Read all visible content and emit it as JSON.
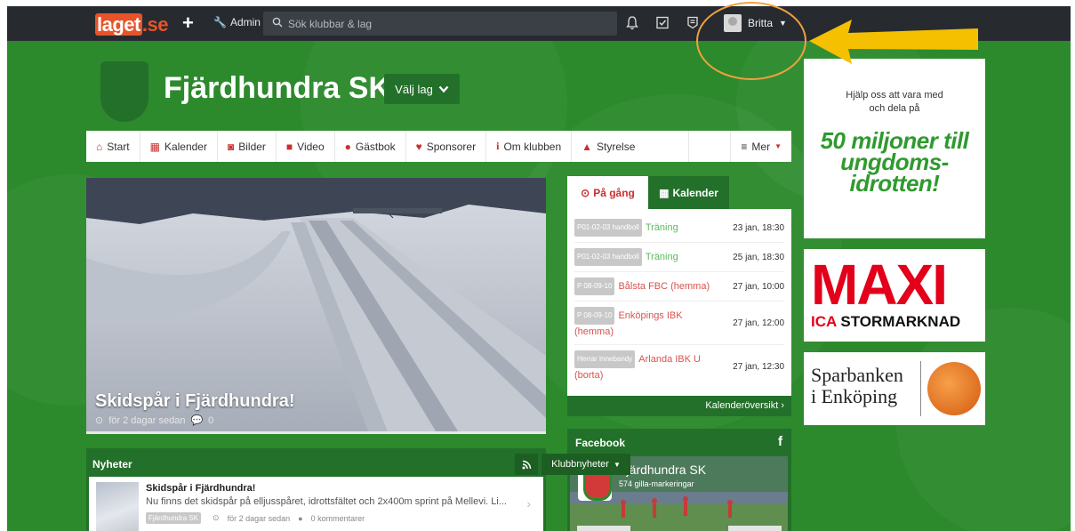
{
  "topbar": {
    "logo_main": "laget",
    "logo_suffix": ".se",
    "admin_label": "Admin",
    "search_placeholder": "Sök klubbar & lag",
    "user_name": "Britta"
  },
  "club": {
    "name": "Fjärdhundra SK",
    "select_team_label": "Välj lag"
  },
  "nav": [
    {
      "label": "Start",
      "icon": "home-icon"
    },
    {
      "label": "Kalender",
      "icon": "calendar-icon"
    },
    {
      "label": "Bilder",
      "icon": "camera-icon"
    },
    {
      "label": "Video",
      "icon": "video-icon"
    },
    {
      "label": "Gästbok",
      "icon": "comments-icon"
    },
    {
      "label": "Sponsorer",
      "icon": "heart-icon"
    },
    {
      "label": "Om klubben",
      "icon": "info-icon"
    },
    {
      "label": "Styrelse",
      "icon": "user-icon"
    }
  ],
  "nav_more": "Mer",
  "hero": {
    "title": "Skidspår i Fjärdhundra!",
    "time": "för 2 dagar sedan",
    "comments": "0"
  },
  "calendar": {
    "tab_upcoming": "På gång",
    "tab_calendar": "Kalender",
    "events": [
      {
        "team": "P01-02-03 handboll",
        "name": "Träning",
        "date": "23 jan, 18:30"
      },
      {
        "team": "P01-02-03 handboll",
        "name": "Träning",
        "date": "25 jan, 18:30"
      },
      {
        "team": "P 08-09-10",
        "name": "Bålsta FBC (hemma)",
        "date": "27 jan, 10:00"
      },
      {
        "team": "P 08-09-10",
        "name": "Enköpings IBK (hemma)",
        "date": "27 jan, 12:00"
      },
      {
        "team": "Herrar Innebandy",
        "name": "Arlanda IBK U (borta)",
        "date": "27 jan, 12:30"
      }
    ],
    "footer_link": "Kalenderöversikt"
  },
  "facebook": {
    "heading": "Facebook",
    "page_name": "Fjärdhundra SK",
    "likes": "574 gilla-markeringar"
  },
  "news": {
    "heading": "Nyheter",
    "category_label": "Klubbnyheter",
    "item": {
      "title": "Skidspår i Fjärdhundra!",
      "text": "Nu finns det skidspår på elljusspåret, idrottsfältet och 2x400m sprint på Mellevi. Li...",
      "source": "Fjärdhundra SK",
      "time": "för 2 dagar sedan",
      "comments": "0 kommentarer"
    }
  },
  "ads": {
    "ad1_small": "Hjälp oss att vara med och dela på",
    "ad1_big": "50 miljoner till ungdoms-idrotten!",
    "ad2_main": "MAXI",
    "ad2_ica": "ICA",
    "ad2_sub": "STORMARKNAD",
    "ad3_line1": "Sparbanken",
    "ad3_line2": "i Enköping"
  },
  "colors": {
    "accent_green": "#2c8a2c",
    "dark_green": "#23702a",
    "brand_red": "#c9302c",
    "annotation_orange": "#f0a040",
    "arrow_yellow": "#f5c000"
  }
}
